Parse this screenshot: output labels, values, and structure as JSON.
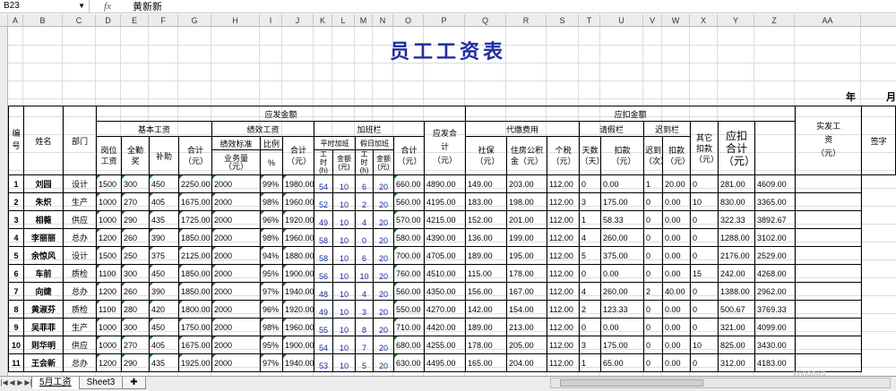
{
  "formula_bar": {
    "name_box": "B23",
    "fx": "fx",
    "value": "黄新新"
  },
  "columns": [
    "A",
    "B",
    "C",
    "D",
    "E",
    "F",
    "G",
    "H",
    "I",
    "J",
    "K",
    "L",
    "M",
    "N",
    "O",
    "P",
    "Q",
    "R",
    "S",
    "T",
    "U",
    "V",
    "W",
    "X",
    "Y",
    "Z",
    "AA"
  ],
  "title": "员工工资表",
  "year_label": "年",
  "month_label": "月",
  "headers": {
    "no": "编号",
    "name": "姓名",
    "dept": "部门",
    "payable": "应发金额",
    "basic": "基本工资",
    "perf": "绩效工资",
    "overtime": "加班栏",
    "payable_total": "应发合计（元）",
    "deduct": "应扣金额",
    "agency": "代缴费用",
    "leave": "请假栏",
    "late": "迟到栏",
    "other_deduct": "其它扣款（元）",
    "deduct_total": "应扣合计（元）",
    "actual": "实发工资（元）",
    "sign": "签字",
    "post_wage": "岗位工资",
    "attend": "全勤奖",
    "subsidy": "补助",
    "sum_yuan": "合计（元）",
    "perf_std": "绩效标准",
    "ratio": "比例",
    "biz_amount": "业务量（元）",
    "pct": "%",
    "ot_weekday": "平时加班",
    "ot_holiday": "假日加班",
    "hours": "工时(h)",
    "amount": "金额(元)",
    "social": "社保（元）",
    "housing": "住房公积金（元）",
    "tax": "个税（元）",
    "days": "天数（天）",
    "deduct_amt": "扣款（元）",
    "late_times": "迟到（次）",
    "late_amt": "扣款（元）"
  },
  "rows": [
    {
      "no": "1",
      "name": "刘园",
      "dept": "设计",
      "post": "1500",
      "att": "300",
      "sub": "450",
      "sum": "2250.00",
      "std": "2000",
      "ratio": "99%",
      "perf_sum": "1980.00",
      "oth": "54",
      "oa": "10",
      "hh": "6",
      "ha": "20",
      "ot_sum": "660.00",
      "pay": "4890.00",
      "soc": "149.00",
      "hous": "203.00",
      "tax": "112.00",
      "days": "0",
      "lv": "0.00",
      "lt": "1",
      "la": "20.00",
      "oth_d": "0",
      "ded": "281.00",
      "act": "4609.00"
    },
    {
      "no": "2",
      "name": "朱炽",
      "dept": "生产",
      "post": "1000",
      "att": "270",
      "sub": "405",
      "sum": "1675.00",
      "std": "2000",
      "ratio": "98%",
      "perf_sum": "1960.00",
      "oth": "52",
      "oa": "10",
      "hh": "2",
      "ha": "20",
      "ot_sum": "560.00",
      "pay": "4195.00",
      "soc": "183.00",
      "hous": "198.00",
      "tax": "112.00",
      "days": "3",
      "lv": "175.00",
      "lt": "0",
      "la": "0.00",
      "oth_d": "10",
      "ded": "830.00",
      "act": "3365.00"
    },
    {
      "no": "3",
      "name": "相薇",
      "dept": "供应",
      "post": "1000",
      "att": "290",
      "sub": "435",
      "sum": "1725.00",
      "std": "2000",
      "ratio": "96%",
      "perf_sum": "1920.00",
      "oth": "49",
      "oa": "10",
      "hh": "4",
      "ha": "20",
      "ot_sum": "570.00",
      "pay": "4215.00",
      "soc": "152.00",
      "hous": "201.00",
      "tax": "112.00",
      "days": "1",
      "lv": "58.33",
      "lt": "0",
      "la": "0.00",
      "oth_d": "0",
      "ded": "322.33",
      "act": "3892.67"
    },
    {
      "no": "4",
      "name": "李丽丽",
      "dept": "总办",
      "post": "1200",
      "att": "260",
      "sub": "390",
      "sum": "1850.00",
      "std": "2000",
      "ratio": "98%",
      "perf_sum": "1960.00",
      "oth": "58",
      "oa": "10",
      "hh": "0",
      "ha": "20",
      "ot_sum": "580.00",
      "pay": "4390.00",
      "soc": "136.00",
      "hous": "199.00",
      "tax": "112.00",
      "days": "4",
      "lv": "260.00",
      "lt": "0",
      "la": "0.00",
      "oth_d": "0",
      "ded": "1288.00",
      "act": "3102.00"
    },
    {
      "no": "5",
      "name": "余惊风",
      "dept": "设计",
      "post": "1500",
      "att": "250",
      "sub": "375",
      "sum": "2125.00",
      "std": "2000",
      "ratio": "94%",
      "perf_sum": "1880.00",
      "oth": "58",
      "oa": "10",
      "hh": "6",
      "ha": "20",
      "ot_sum": "700.00",
      "pay": "4705.00",
      "soc": "189.00",
      "hous": "195.00",
      "tax": "112.00",
      "days": "5",
      "lv": "375.00",
      "lt": "0",
      "la": "0.00",
      "oth_d": "0",
      "ded": "2176.00",
      "act": "2529.00"
    },
    {
      "no": "6",
      "name": "车前",
      "dept": "质检",
      "post": "1100",
      "att": "300",
      "sub": "450",
      "sum": "1850.00",
      "std": "2000",
      "ratio": "95%",
      "perf_sum": "1900.00",
      "oth": "56",
      "oa": "10",
      "hh": "10",
      "ha": "20",
      "ot_sum": "760.00",
      "pay": "4510.00",
      "soc": "115.00",
      "hous": "178.00",
      "tax": "112.00",
      "days": "0",
      "lv": "0.00",
      "lt": "0",
      "la": "0.00",
      "oth_d": "15",
      "ded": "242.00",
      "act": "4268.00"
    },
    {
      "no": "7",
      "name": "向婕",
      "dept": "总办",
      "post": "1200",
      "att": "260",
      "sub": "390",
      "sum": "1850.00",
      "std": "2000",
      "ratio": "97%",
      "perf_sum": "1940.00",
      "oth": "48",
      "oa": "10",
      "hh": "4",
      "ha": "20",
      "ot_sum": "560.00",
      "pay": "4350.00",
      "soc": "156.00",
      "hous": "167.00",
      "tax": "112.00",
      "days": "4",
      "lv": "260.00",
      "lt": "2",
      "la": "40.00",
      "oth_d": "0",
      "ded": "1388.00",
      "act": "2962.00"
    },
    {
      "no": "8",
      "name": "黄淑芬",
      "dept": "质检",
      "post": "1100",
      "att": "280",
      "sub": "420",
      "sum": "1800.00",
      "std": "2000",
      "ratio": "96%",
      "perf_sum": "1920.00",
      "oth": "49",
      "oa": "10",
      "hh": "3",
      "ha": "20",
      "ot_sum": "550.00",
      "pay": "4270.00",
      "soc": "142.00",
      "hous": "154.00",
      "tax": "112.00",
      "days": "2",
      "lv": "123.33",
      "lt": "0",
      "la": "0.00",
      "oth_d": "0",
      "ded": "500.67",
      "act": "3769.33"
    },
    {
      "no": "9",
      "name": "吴菲菲",
      "dept": "生产",
      "post": "1000",
      "att": "300",
      "sub": "450",
      "sum": "1750.00",
      "std": "2000",
      "ratio": "98%",
      "perf_sum": "1960.00",
      "oth": "55",
      "oa": "10",
      "hh": "8",
      "ha": "20",
      "ot_sum": "710.00",
      "pay": "4420.00",
      "soc": "189.00",
      "hous": "213.00",
      "tax": "112.00",
      "days": "0",
      "lv": "0.00",
      "lt": "0",
      "la": "0.00",
      "oth_d": "0",
      "ded": "321.00",
      "act": "4099.00"
    },
    {
      "no": "10",
      "name": "则华明",
      "dept": "供应",
      "post": "1000",
      "att": "270",
      "sub": "405",
      "sum": "1675.00",
      "std": "2000",
      "ratio": "95%",
      "perf_sum": "1900.00",
      "oth": "54",
      "oa": "10",
      "hh": "7",
      "ha": "20",
      "ot_sum": "680.00",
      "pay": "4255.00",
      "soc": "178.00",
      "hous": "205.00",
      "tax": "112.00",
      "days": "3",
      "lv": "175.00",
      "lt": "0",
      "la": "0.00",
      "oth_d": "10",
      "ded": "825.00",
      "act": "3430.00"
    },
    {
      "no": "11",
      "name": "王会新",
      "dept": "总办",
      "post": "1200",
      "att": "290",
      "sub": "435",
      "sum": "1925.00",
      "std": "2000",
      "ratio": "97%",
      "perf_sum": "1940.00",
      "oth": "53",
      "oa": "10",
      "hh": "5",
      "ha": "20",
      "ot_sum": "630.00",
      "pay": "4495.00",
      "soc": "165.00",
      "hous": "204.00",
      "tax": "112.00",
      "days": "1",
      "lv": "65.00",
      "lt": "0",
      "la": "0.00",
      "oth_d": "0",
      "ded": "312.00",
      "act": "4183.00"
    }
  ],
  "tabs": [
    "5月工资",
    "Sheet3"
  ],
  "watermark": "Windows"
}
